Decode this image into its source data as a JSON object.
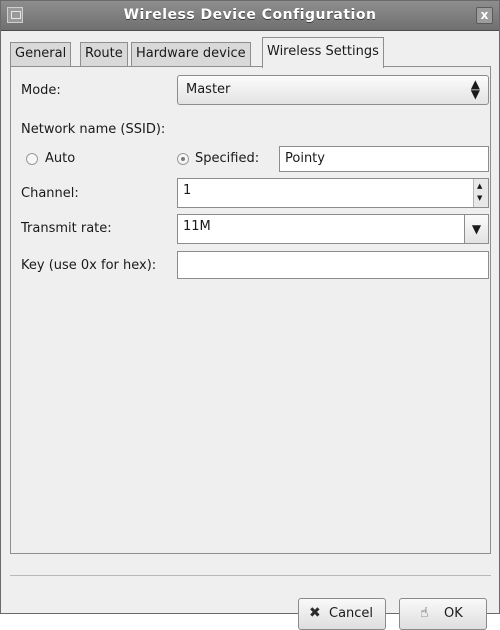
{
  "window": {
    "title": "Wireless Device Configuration",
    "close_glyph": "x"
  },
  "tabs": [
    {
      "label": "General"
    },
    {
      "label": "Route"
    },
    {
      "label": "Hardware device"
    },
    {
      "label": "Wireless Settings",
      "active": true
    }
  ],
  "form": {
    "mode_label": "Mode:",
    "mode_value": "Master",
    "ssid_label": "Network name (SSID):",
    "auto_label": "Auto",
    "specified_label": "Specified:",
    "ssid_value": "Pointy",
    "channel_label": "Channel:",
    "channel_value": "1",
    "rate_label": "Transmit rate:",
    "rate_value": "11M",
    "key_label": "Key (use 0x for hex):",
    "key_value": ""
  },
  "buttons": {
    "cancel_label": "Cancel",
    "ok_label": "OK"
  },
  "icons": {
    "cancel": "x-mark-icon",
    "ok": "hand-thumb-icon",
    "mode_arrow": "up-down-arrows-icon",
    "rate_arrow": "triangle-down-icon"
  }
}
